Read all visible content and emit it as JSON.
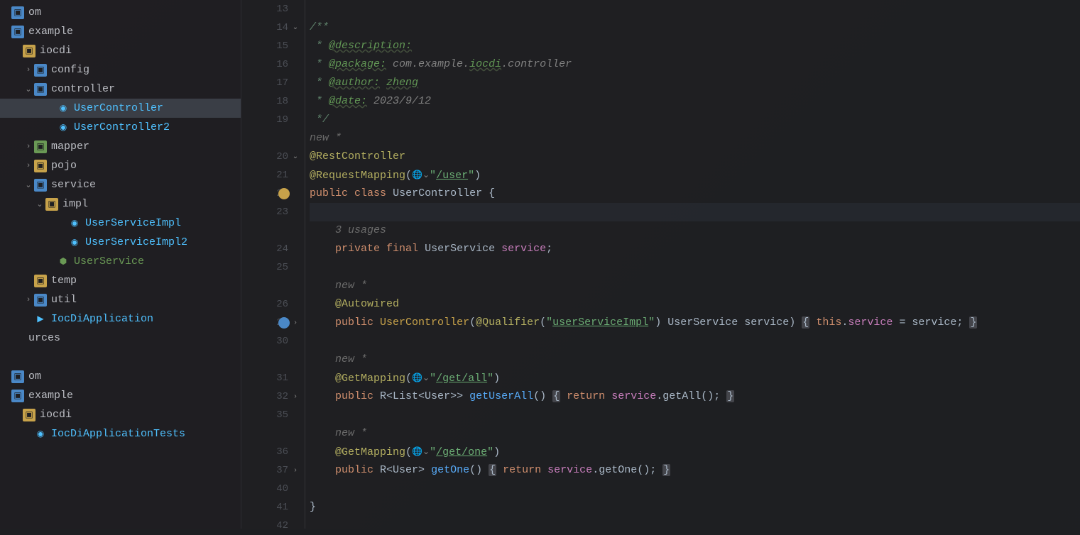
{
  "sidebar": {
    "items": [
      {
        "indent": 0,
        "chev": "",
        "icon": "folder",
        "label": "om"
      },
      {
        "indent": 0,
        "chev": "",
        "icon": "folder",
        "label": "example"
      },
      {
        "indent": 1,
        "chev": "",
        "icon": "folder-y",
        "label": "iocdi"
      },
      {
        "indent": 2,
        "chev": "›",
        "icon": "folder",
        "label": "config"
      },
      {
        "indent": 2,
        "chev": "⌄",
        "icon": "folder",
        "label": "controller"
      },
      {
        "indent": 4,
        "chev": "",
        "icon": "class",
        "label": "UserController",
        "selected": true
      },
      {
        "indent": 4,
        "chev": "",
        "icon": "class",
        "label": "UserController2"
      },
      {
        "indent": 2,
        "chev": "›",
        "icon": "folder-g",
        "label": "mapper"
      },
      {
        "indent": 2,
        "chev": "›",
        "icon": "folder-y",
        "label": "pojo"
      },
      {
        "indent": 2,
        "chev": "⌄",
        "icon": "folder",
        "label": "service"
      },
      {
        "indent": 3,
        "chev": "⌄",
        "icon": "folder-y",
        "label": "impl"
      },
      {
        "indent": 5,
        "chev": "",
        "icon": "class",
        "label": "UserServiceImpl"
      },
      {
        "indent": 5,
        "chev": "",
        "icon": "class",
        "label": "UserServiceImpl2"
      },
      {
        "indent": 4,
        "chev": "",
        "icon": "interface",
        "label": "UserService"
      },
      {
        "indent": 2,
        "chev": "",
        "icon": "folder-y",
        "label": "temp"
      },
      {
        "indent": 2,
        "chev": "›",
        "icon": "folder",
        "label": "util"
      },
      {
        "indent": 2,
        "chev": "",
        "icon": "app",
        "label": "IocDiApplication"
      },
      {
        "indent": 0,
        "chev": "",
        "icon": "",
        "label": "urces"
      },
      {
        "indent": 0,
        "chev": "",
        "icon": "",
        "label": ""
      },
      {
        "indent": 0,
        "chev": "",
        "icon": "folder",
        "label": "om"
      },
      {
        "indent": 0,
        "chev": "",
        "icon": "folder",
        "label": "example"
      },
      {
        "indent": 1,
        "chev": "",
        "icon": "folder-y",
        "label": "iocdi"
      },
      {
        "indent": 2,
        "chev": "",
        "icon": "class",
        "label": "IocDiApplicationTests"
      }
    ]
  },
  "editor": {
    "lines": [
      {
        "num": "13",
        "fold": "",
        "html": ""
      },
      {
        "num": "14",
        "fold": "⌄",
        "html": "<span class='cm'>/**</span>"
      },
      {
        "num": "15",
        "fold": "",
        "html": "<span class='cm'> * </span><span class='cm-tag'>@description:</span>"
      },
      {
        "num": "16",
        "fold": "",
        "html": "<span class='cm'> * </span><span class='cm-tag'>@package:</span><span class='cm-val'> com.example.</span><span class='cm-tag'>iocdi</span><span class='cm-val'>.controller</span>"
      },
      {
        "num": "17",
        "fold": "",
        "html": "<span class='cm'> * </span><span class='cm-tag'>@author:</span><span class='cm-val'> </span><span class='cm-tag'>zheng</span>"
      },
      {
        "num": "18",
        "fold": "",
        "html": "<span class='cm'> * </span><span class='cm-tag'>@date:</span><span class='cm-val'> 2023/9/12</span>"
      },
      {
        "num": "19",
        "fold": "",
        "html": "<span class='cm'> */</span>"
      },
      {
        "num": "",
        "fold": "",
        "html": "<span class='hint'>new *</span>"
      },
      {
        "num": "20",
        "fold": "⌄",
        "html": "<span class='anno'>@RestController</span>"
      },
      {
        "num": "21",
        "fold": "",
        "html": "<span class='anno'>@RequestMapping</span><span class='op'>(</span><span class='globe-ico'>🌐⌄</span><span class='str'>\"</span><span class='str-u'>/user</span><span class='str'>\"</span><span class='op'>)</span>"
      },
      {
        "num": "22",
        "fold": "",
        "mark": "class",
        "html": "<span class='kw'>public</span> <span class='kw'>class</span> <span class='cls'>UserController</span> <span class='op'>{</span>"
      },
      {
        "num": "23",
        "fold": "",
        "cursor": true,
        "html": ""
      },
      {
        "num": "",
        "fold": "",
        "html": "    <span class='hint'>3 usages</span>"
      },
      {
        "num": "24",
        "fold": "",
        "html": "    <span class='kw'>private</span> <span class='kw'>final</span> <span class='cls'>UserService</span> <span class='field'>service</span><span class='op'>;</span>"
      },
      {
        "num": "25",
        "fold": "",
        "html": ""
      },
      {
        "num": "",
        "fold": "",
        "html": "    <span class='hint'>new *</span>"
      },
      {
        "num": "26",
        "fold": "",
        "html": "    <span class='anno'>@Autowired</span>"
      },
      {
        "num": "27",
        "fold": "›",
        "mark": "bean",
        "html": "    <span class='kw'>public</span> <span class='fn-y'>UserController</span><span class='op'>(</span><span class='anno'>@Qualifier</span><span class='op'>(</span><span class='str'>\"</span><span class='str-u'>userServiceImpl</span><span class='str'>\"</span><span class='op'>)</span> <span class='cls'>UserService</span> <span class='op'>service) </span><span class='brace-hl'>{</span> <span class='kw'>this</span><span class='op'>.</span><span class='field'>service</span> <span class='op'>=</span> <span class='op'>service;</span> <span class='brace-hl'>}</span>"
      },
      {
        "num": "30",
        "fold": "",
        "html": ""
      },
      {
        "num": "",
        "fold": "",
        "html": "    <span class='hint'>new *</span>"
      },
      {
        "num": "31",
        "fold": "",
        "html": "    <span class='anno'>@GetMapping</span><span class='op'>(</span><span class='globe-ico'>🌐⌄</span><span class='str'>\"</span><span class='str-u'>/get/all</span><span class='str'>\"</span><span class='op'>)</span>"
      },
      {
        "num": "32",
        "fold": "›",
        "html": "    <span class='kw'>public</span> <span class='cls'>R&lt;List&lt;User&gt;&gt;</span> <span class='fn'>getUserAll</span><span class='op'>() </span><span class='brace-hl'>{</span> <span class='kw'>return</span> <span class='field'>service</span><span class='op'>.getAll();</span> <span class='brace-hl'>}</span>"
      },
      {
        "num": "35",
        "fold": "",
        "html": ""
      },
      {
        "num": "",
        "fold": "",
        "html": "    <span class='hint'>new *</span>"
      },
      {
        "num": "36",
        "fold": "",
        "html": "    <span class='anno'>@GetMapping</span><span class='op'>(</span><span class='globe-ico'>🌐⌄</span><span class='str'>\"</span><span class='str-u'>/get/one</span><span class='str'>\"</span><span class='op'>)</span>"
      },
      {
        "num": "37",
        "fold": "›",
        "html": "    <span class='kw'>public</span> <span class='cls'>R&lt;User&gt;</span> <span class='fn'>getOne</span><span class='op'>() </span><span class='brace-hl'>{</span> <span class='kw'>return</span> <span class='field'>service</span><span class='op'>.getOne();</span> <span class='brace-hl'>}</span>"
      },
      {
        "num": "40",
        "fold": "",
        "html": ""
      },
      {
        "num": "41",
        "fold": "",
        "html": "<span class='op'>}</span>"
      },
      {
        "num": "42",
        "fold": "",
        "html": ""
      }
    ]
  }
}
